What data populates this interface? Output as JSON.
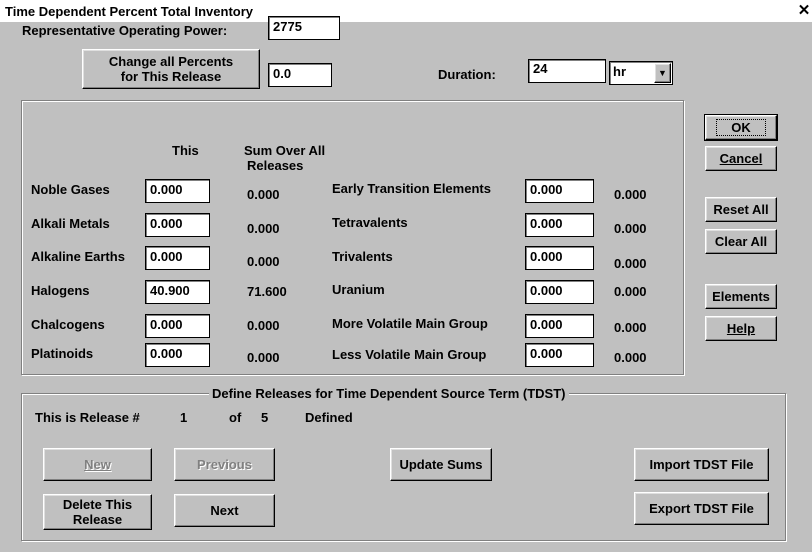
{
  "window": {
    "title": "Time Dependent Percent Total Inventory"
  },
  "operating_power": {
    "label": "Representative Operating Power:",
    "value": "2775"
  },
  "change_percents": {
    "button_line1": "Change all Percents",
    "button_line2": "for This Release",
    "value": "0.0"
  },
  "duration": {
    "label": "Duration:",
    "value": "24",
    "unit": "hr"
  },
  "columns": {
    "this_release": "This",
    "sum_line1": "Sum Over All",
    "sum_line2": "Releases"
  },
  "left_groups": [
    {
      "label": "Noble Gases",
      "value": "0.000",
      "sum": "0.000"
    },
    {
      "label": "Alkali Metals",
      "value": "0.000",
      "sum": "0.000"
    },
    {
      "label": "Alkaline Earths",
      "value": "0.000",
      "sum": "0.000"
    },
    {
      "label": "Halogens",
      "value": "40.900",
      "sum": "71.600"
    },
    {
      "label": "Chalcogens",
      "value": "0.000",
      "sum": "0.000"
    },
    {
      "label": "Platinoids",
      "value": "0.000",
      "sum": "0.000"
    }
  ],
  "right_groups": [
    {
      "label": "Early Transition Elements",
      "value": "0.000",
      "sum": "0.000"
    },
    {
      "label": "Tetravalents",
      "value": "0.000",
      "sum": "0.000"
    },
    {
      "label": "Trivalents",
      "value": "0.000",
      "sum": "0.000"
    },
    {
      "label": "Uranium",
      "value": "0.000",
      "sum": "0.000"
    },
    {
      "label": "More Volatile Main Group",
      "value": "0.000",
      "sum": "0.000"
    },
    {
      "label": "Less Volatile Main Group",
      "value": "0.000",
      "sum": "0.000"
    }
  ],
  "side_buttons": {
    "ok": "OK",
    "cancel": "Cancel",
    "reset_all": "Reset All",
    "clear_all": "Clear All",
    "elements": "Elements",
    "help": "Help"
  },
  "releases": {
    "group_title": "Define Releases for Time Dependent Source Term (TDST)",
    "status_prefix": "This is Release #",
    "current": "1",
    "of_label": "of",
    "total": "5",
    "defined_label": "Defined",
    "new": "New",
    "previous": "Previous",
    "update_sums": "Update Sums",
    "import": "Import TDST File",
    "delete_line1": "Delete This",
    "delete_line2": "Release",
    "next": "Next",
    "export": "Export TDST File"
  }
}
